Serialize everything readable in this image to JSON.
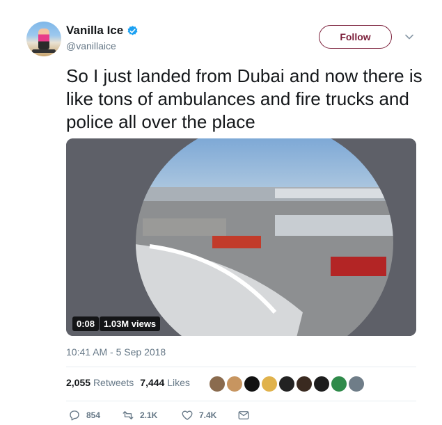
{
  "author": {
    "display_name": "Vanilla Ice",
    "handle": "@vanillaice",
    "verified": true,
    "avatar_icon": "avatar-photo"
  },
  "follow_button": {
    "label": "Follow"
  },
  "menu_icon": "chevron-down-icon",
  "tweet": {
    "text": "So I just landed from Dubai and now there is like tons of ambulances and fire trucks and police all over the place"
  },
  "video": {
    "duration": "0:08",
    "views": "1.03M views"
  },
  "timestamp": "10:41 AM - 5 Sep 2018",
  "stats": {
    "retweets_count": "2,055",
    "retweets_label": "Retweets",
    "likes_count": "7,444",
    "likes_label": "Likes"
  },
  "liker_avatars": [
    "#8a6b4e",
    "#c79560",
    "#111111",
    "#e0b24c",
    "#222222",
    "#3a2a20",
    "#1d1d1d",
    "#2f8a4a",
    "#6f7d88"
  ],
  "actions": {
    "replies": "854",
    "retweets": "2.1K",
    "likes": "7.4K"
  },
  "colors": {
    "follow_border": "#7b1f3a",
    "verified_blue": "#1da1f2",
    "secondary_text": "#657786"
  }
}
